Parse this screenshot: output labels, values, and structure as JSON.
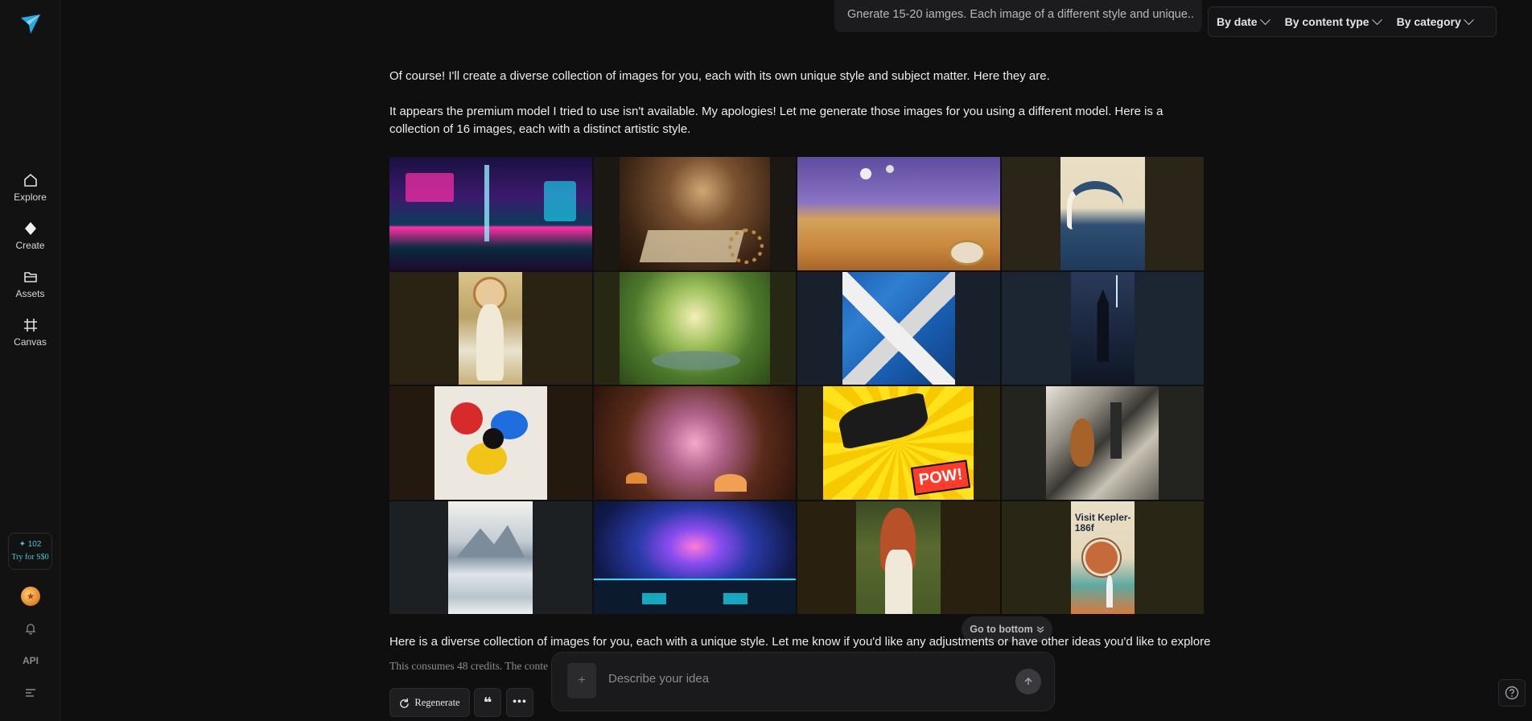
{
  "sidebar": {
    "nav": [
      {
        "label": "Explore",
        "icon": "home-icon"
      },
      {
        "label": "Create",
        "icon": "diamond-icon"
      },
      {
        "label": "Assets",
        "icon": "folder-icon"
      },
      {
        "label": "Canvas",
        "icon": "frame-icon"
      }
    ],
    "credits": {
      "count": "102",
      "try_label": "Try for S$0"
    },
    "api_label": "API"
  },
  "topbar": {
    "prompt_preview": "Gnerate 15-20 iamges. Each image of a different style and unique..",
    "filters": [
      "By date",
      "By content type",
      "By category"
    ]
  },
  "chat": {
    "intro": "Of course! I'll create a diverse collection of images for you, each with its own unique style and subject matter. Here they are.",
    "apology": "It appears the premium model I tried to use isn't available. My apologies! Let me generate those images for you using a different model. Here is a collection of 16 images, each with a distinct artistic style.",
    "summary": "Here is a diverse collection of images for you, each with a unique style. Let me know if you'd like any adjustments or have other ideas you'd like to explore",
    "credit_note": "This consumes 48 credits. The conte",
    "go_to_bottom": "Go to bottom",
    "regenerate": "Regenerate",
    "poster_text": "Visit Kepler-186f",
    "comic_text": "POW!"
  },
  "composer": {
    "placeholder": "Describe your idea"
  },
  "colors": {
    "accent": "#3ec9d6",
    "background": "#0f0f10",
    "logo": "#2aa8e0"
  }
}
